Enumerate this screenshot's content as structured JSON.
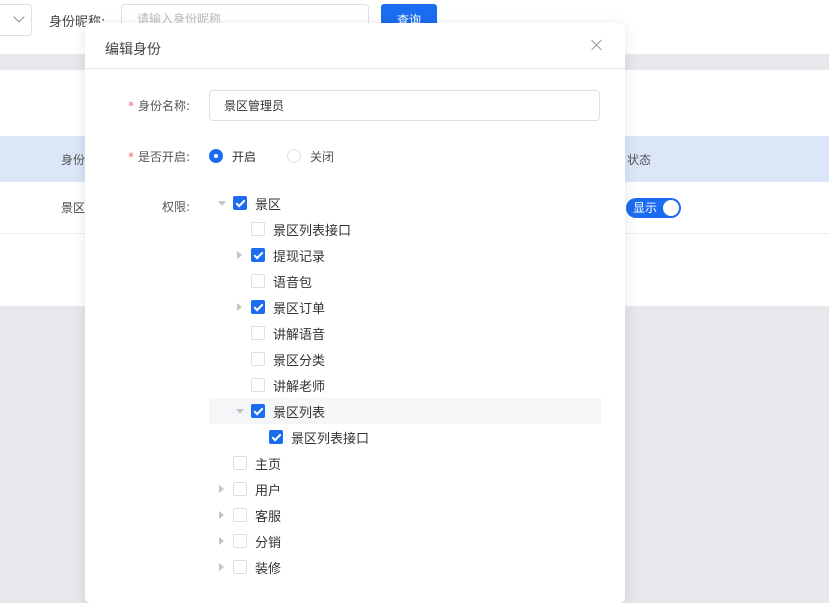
{
  "filter": {
    "label": "身份昵称:",
    "placeholder": "请输入身份昵称",
    "search_button": "查询"
  },
  "table": {
    "headers": [
      "身份",
      "状态"
    ],
    "row": {
      "name": "景区",
      "status_label": "显示"
    }
  },
  "dialog": {
    "title": "编辑身份",
    "name_label": "身份名称:",
    "name_value": "景区管理员",
    "enabled_label": "是否开启:",
    "radio_on": "开启",
    "radio_off": "关闭",
    "perm_label": "权限:",
    "tree": [
      {
        "label": "景区",
        "checked": true,
        "expander": "open"
      },
      {
        "label": "景区列表接口",
        "checked": false,
        "expander": "none"
      },
      {
        "label": "提现记录",
        "checked": true,
        "expander": "closed"
      },
      {
        "label": "语音包",
        "checked": false,
        "expander": "none"
      },
      {
        "label": "景区订单",
        "checked": true,
        "expander": "closed"
      },
      {
        "label": "讲解语音",
        "checked": false,
        "expander": "none"
      },
      {
        "label": "景区分类",
        "checked": false,
        "expander": "none"
      },
      {
        "label": "讲解老师",
        "checked": false,
        "expander": "none"
      },
      {
        "label": "景区列表",
        "checked": true,
        "expander": "open"
      },
      {
        "label": "景区列表接口",
        "checked": true,
        "expander": "none"
      },
      {
        "label": "主页",
        "checked": false,
        "expander": "none"
      },
      {
        "label": "用户",
        "checked": false,
        "expander": "closed"
      },
      {
        "label": "客服",
        "checked": false,
        "expander": "closed"
      },
      {
        "label": "分销",
        "checked": false,
        "expander": "closed"
      },
      {
        "label": "装修",
        "checked": false,
        "expander": "closed"
      }
    ]
  },
  "colors": {
    "primary": "#1a6cf0",
    "required": "#f56c6c",
    "table_header": "#dbe6f8"
  }
}
